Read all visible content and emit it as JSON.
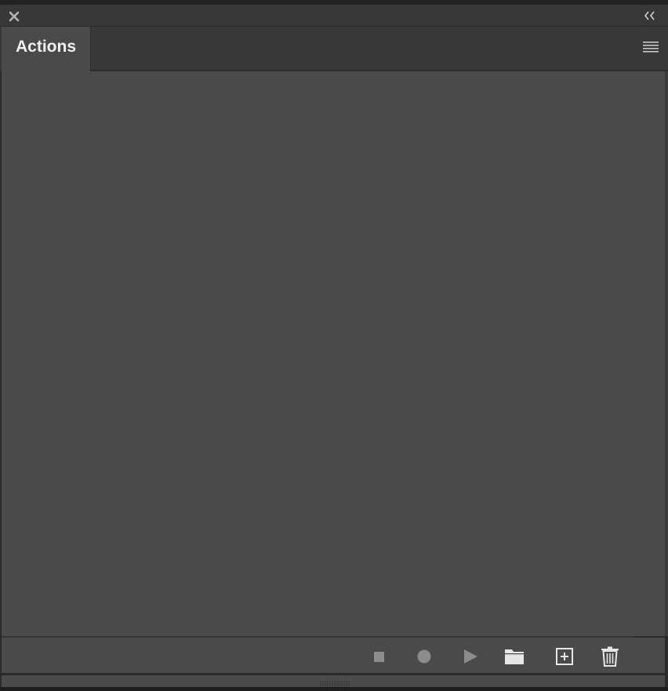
{
  "window": {
    "close_icon": "close-icon",
    "collapse_icon": "double-chevron-left-icon"
  },
  "tabs": [
    {
      "label": "Actions",
      "active": true
    }
  ],
  "panel_menu_icon": "hamburger-menu-icon",
  "actions_list": [],
  "footer": {
    "buttons": [
      {
        "icon": "stop-icon",
        "enabled": true
      },
      {
        "icon": "record-icon",
        "enabled": true
      },
      {
        "icon": "play-icon",
        "enabled": true
      },
      {
        "icon": "folder-icon",
        "enabled": true
      },
      {
        "icon": "new-action-icon",
        "enabled": true
      },
      {
        "icon": "trash-icon",
        "enabled": true
      }
    ]
  },
  "colors": {
    "panel_background": "#4a4a4a",
    "header_background": "#383838",
    "tab_text": "#f0f0f0",
    "icon_disabled": "#8c8c8c",
    "icon_enabled": "#e6e6e6"
  }
}
